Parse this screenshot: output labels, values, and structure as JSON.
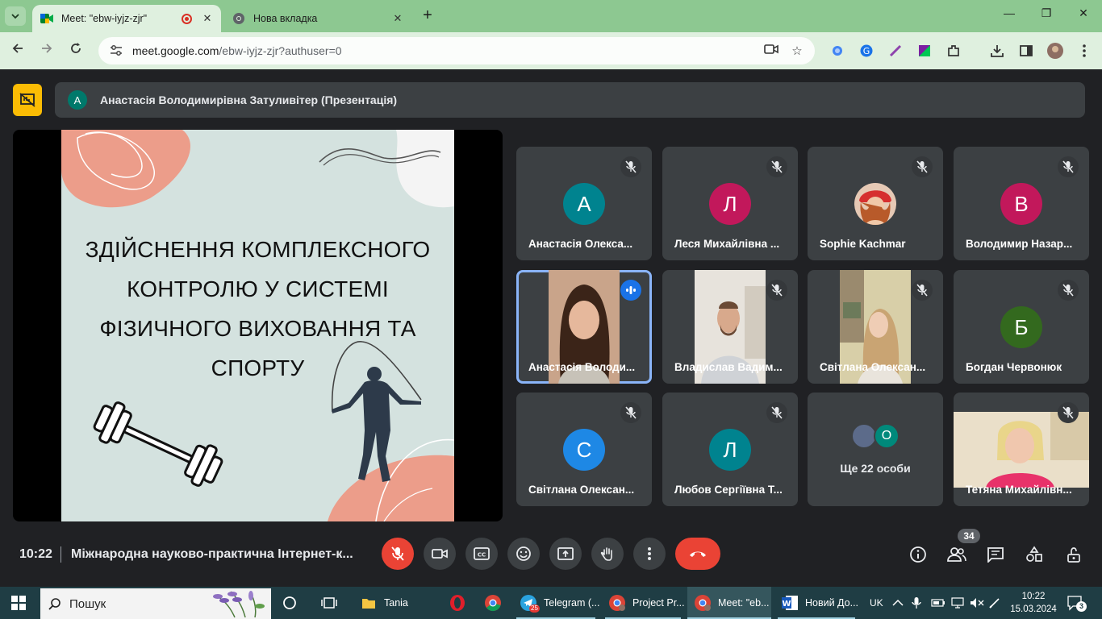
{
  "browser": {
    "tabs": [
      {
        "title": "Meet: \"ebw-iyjz-zjr\"",
        "active": true,
        "recording": true
      },
      {
        "title": "Нова вкладка",
        "active": false
      }
    ],
    "url_host": "meet.google.com",
    "url_rest": "/ebw-iyjz-zjr?authuser=0"
  },
  "meet": {
    "presenter_initial": "А",
    "presenter_name": "Анастасія Володимирівна Затуливітер (Презентація)",
    "slide": {
      "title_lines": [
        "ЗДІЙСНЕННЯ КОМПЛЕКСНОГО",
        "КОНТРОЛЮ У СИСТЕМІ",
        "ФІЗИЧНОГО ВИХОВАННЯ ТА",
        "СПОРТУ"
      ]
    },
    "participants": [
      {
        "name": "Анастасія Олекса...",
        "initial": "А",
        "color": "#00838f",
        "type": "avatar"
      },
      {
        "name": "Леся Михайлівна ...",
        "initial": "Л",
        "color": "#c2185b",
        "type": "avatar"
      },
      {
        "name": "Sophie Kachmar",
        "initial": "",
        "color": "#c0392b",
        "type": "photo"
      },
      {
        "name": "Володимир Назар...",
        "initial": "В",
        "color": "#c2185b",
        "type": "avatar"
      },
      {
        "name": "Анастасія Володи...",
        "initial": "",
        "color": "#8a6a55",
        "type": "video",
        "speaking": true
      },
      {
        "name": "Владислав Вадим...",
        "initial": "",
        "color": "#b8b2aa",
        "type": "video"
      },
      {
        "name": "Світлана Олексан...",
        "initial": "",
        "color": "#9a8a6e",
        "type": "video"
      },
      {
        "name": "Богдан Червонюк",
        "initial": "Б",
        "color": "#33691e",
        "type": "avatar"
      },
      {
        "name": "Світлана Олексан...",
        "initial": "С",
        "color": "#1e88e5",
        "type": "avatar"
      },
      {
        "name": "Любов Сергіївна Т...",
        "initial": "Л",
        "color": "#00838f",
        "type": "avatar"
      },
      {
        "name": "Ще 22 особи",
        "initial": "О",
        "color": "#00897b",
        "type": "more"
      },
      {
        "name": "Тетяна Михайлівн...",
        "initial": "",
        "color": "#d9c9b0",
        "type": "video"
      }
    ],
    "bottom": {
      "time": "10:22",
      "meeting_title": "Міжнародна науково-практична Інтернет-к...",
      "people_count": "34"
    }
  },
  "taskbar": {
    "search_label": "Пошук",
    "items": [
      {
        "label": "Tania"
      },
      {
        "label": "Telegram (..."
      },
      {
        "label": "Project Pr..."
      },
      {
        "label": "Meet: \"eb..."
      },
      {
        "label": "Новий До..."
      }
    ],
    "telegram_badge": "25",
    "lang": "UK",
    "time": "10:22",
    "date": "15.03.2024",
    "notif_count": "3"
  }
}
